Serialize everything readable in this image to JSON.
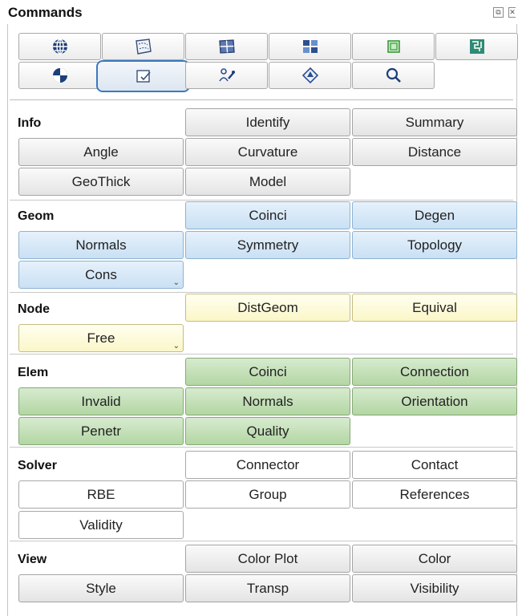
{
  "panel": {
    "title": "Commands"
  },
  "toolbar": {
    "row1_icons": [
      "globe-icon",
      "surface-patch-icon",
      "mesh-face-icon",
      "blue-grid-icon",
      "green-cube-icon",
      "teal-maze-icon"
    ],
    "row2_icons": [
      "half-sphere-icon",
      "checkmark-box-icon",
      "people-tool-icon",
      "diamond-arrow-icon",
      "magnifier-icon"
    ],
    "selected": "checkmark-box-icon"
  },
  "sections": {
    "info": {
      "label": "Info",
      "buttons": [
        "Identify",
        "Summary",
        "Angle",
        "Curvature",
        "Distance",
        "GeoThick",
        "Model"
      ]
    },
    "geom": {
      "label": "Geom",
      "buttons": [
        "Coinci",
        "Degen",
        "Normals",
        "Symmetry",
        "Topology",
        "Cons"
      ]
    },
    "node": {
      "label": "Node",
      "buttons": [
        "DistGeom",
        "Equival",
        "Free"
      ]
    },
    "elem": {
      "label": "Elem",
      "buttons": [
        "Coinci",
        "Connection",
        "Invalid",
        "Normals",
        "Orientation",
        "Penetr",
        "Quality"
      ]
    },
    "solver": {
      "label": "Solver",
      "buttons": [
        "Connector",
        "Contact",
        "RBE",
        "Group",
        "References",
        "Validity"
      ]
    },
    "view": {
      "label": "View",
      "buttons": [
        "Color Plot",
        "Color",
        "Style",
        "Transp",
        "Visibility"
      ]
    }
  },
  "colors": {
    "info": "#e4e4e4",
    "geom": "#c9e0f4",
    "node": "#fbf6c8",
    "elem": "#b3d6a3",
    "solver": "#ffffff",
    "view": "#e4e4e4",
    "selection": "#3a78c2"
  }
}
